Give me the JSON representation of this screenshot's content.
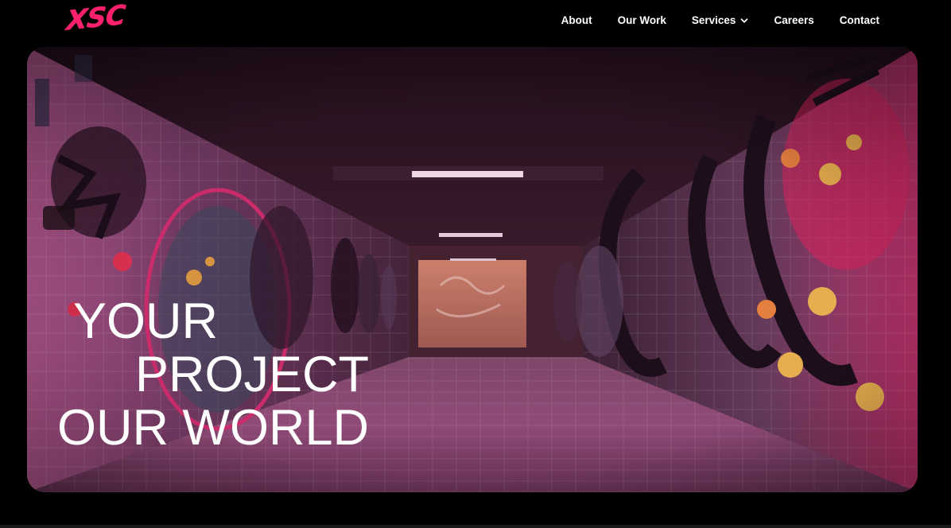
{
  "header": {
    "logo_text": "XSC",
    "nav": [
      {
        "label": "About"
      },
      {
        "label": "Our Work"
      },
      {
        "label": "Services",
        "has_dropdown": true
      },
      {
        "label": "Careers"
      },
      {
        "label": "Contact"
      }
    ]
  },
  "hero": {
    "headline_line1": "YOUR",
    "headline_line2": "PROJECT",
    "headline_line3": "OUR WORLD",
    "image_subject": "graffiti-covered pedestrian tunnel"
  },
  "colors": {
    "background": "#000000",
    "brand_pink": "#ff1f6a",
    "nav_text": "#ffffff",
    "headline_text": "#ffffff"
  },
  "icons": {
    "services_dropdown": "chevron-down-icon"
  }
}
